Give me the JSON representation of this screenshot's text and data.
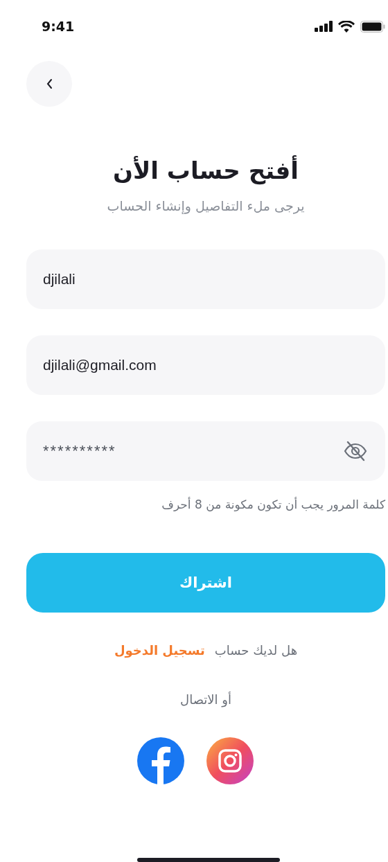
{
  "status_bar": {
    "time": "9:41"
  },
  "title": "أفتح حساب الأن",
  "subtitle": "يرجى ملء التفاصيل وإنشاء الحساب",
  "fields": [
    {
      "kind": "text",
      "value": "djilali"
    },
    {
      "kind": "text",
      "value": "djilali@gmail.com"
    },
    {
      "kind": "password",
      "value": "**********"
    }
  ],
  "password_hint": "كلمة المرور يجب أن تكون مكونة من 8 أحرف",
  "submit_button": "اشتراك",
  "login_prompt": {
    "text": "هل لديك حساب",
    "link": "تسجيل الدخول"
  },
  "divider_text": "أو الاتصال"
}
